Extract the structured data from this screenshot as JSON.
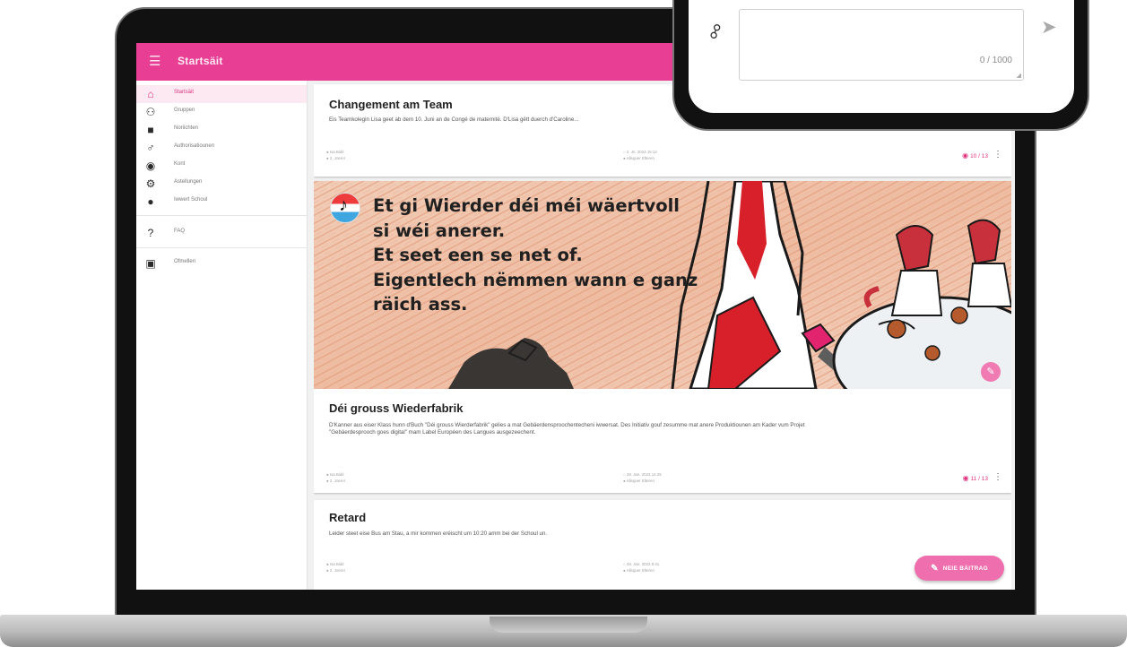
{
  "app": {
    "title": "Startsäit",
    "accent": "#e83e94"
  },
  "sidebar": {
    "items": [
      {
        "icon": "home-icon",
        "glyph": "⌂",
        "label": "Startsäit",
        "active": true
      },
      {
        "icon": "groups-icon",
        "glyph": "⚇",
        "label": "Gruppen"
      },
      {
        "icon": "chat-icon",
        "glyph": "■",
        "label": "Noriichten"
      },
      {
        "icon": "person-icon",
        "glyph": "♂",
        "label": "Authorisatiounen"
      },
      {
        "icon": "account-circle-icon",
        "glyph": "◉",
        "label": "Kont"
      },
      {
        "icon": "settings-gear-icon",
        "glyph": "⚙",
        "label": "Astellungen"
      },
      {
        "icon": "info-icon",
        "glyph": "●",
        "label": "Iwwert Schoul"
      },
      {
        "icon": "help-icon",
        "glyph": "?",
        "label": "FAQ"
      },
      {
        "icon": "logout-icon",
        "glyph": "▣",
        "label": "Ofmellen"
      }
    ]
  },
  "posts": [
    {
      "title": "Changement am Team",
      "text": "Eis Teamkolegin Lisa geet ab dem 10. Juni an de Congé de maternité. D'Lisa gëtt duerch d'Caroline...",
      "author": "Isa Bidé",
      "audience": "2. Joerer",
      "date": "2. Jn. 2023 15:12",
      "recipients": "Alleguer Elteren",
      "views": "10 / 13"
    },
    {
      "illustration_text": [
        "Et gi Wierder déi méi wäertvoll",
        "si wéi anerer.",
        "Et seet een se net of.",
        "Eigentlech nëmmen wann e ganz",
        "räich ass."
      ],
      "title": "Déi grouss Wiederfabrik",
      "text": "D'Kanner aus eiser Klass hunn d'Buch \"Déi grouss Wierderfabrik\" gelies a mat Gebäerdensproochentecheni iwwersat. Des Initiativ gouf zesumme mat anere Produktiounen am Kader vum Projet \"Gebäerdesprooch goes digital\" mam Label Européen des Langues ausgezeechent.",
      "author": "Isa Bidé",
      "audience": "2. Joerer",
      "date": "28. Jan. 2023 14:25",
      "recipients": "Alleguer Elteren",
      "views": "11 / 13"
    },
    {
      "title": "Retard",
      "text": "Leider steet eise Bus am Stau, a mir kommen eréischt um 10:20 amm bei der Schoul un.",
      "author": "Isa Bidé",
      "audience": "2. Joerer",
      "date": "28. Jan. 2023 9:41",
      "recipients": "Alleguer Elteren",
      "views": ""
    }
  ],
  "fab": {
    "label": "NEIE BÄITRAG"
  },
  "phone": {
    "char_counter": "0 / 1000"
  }
}
